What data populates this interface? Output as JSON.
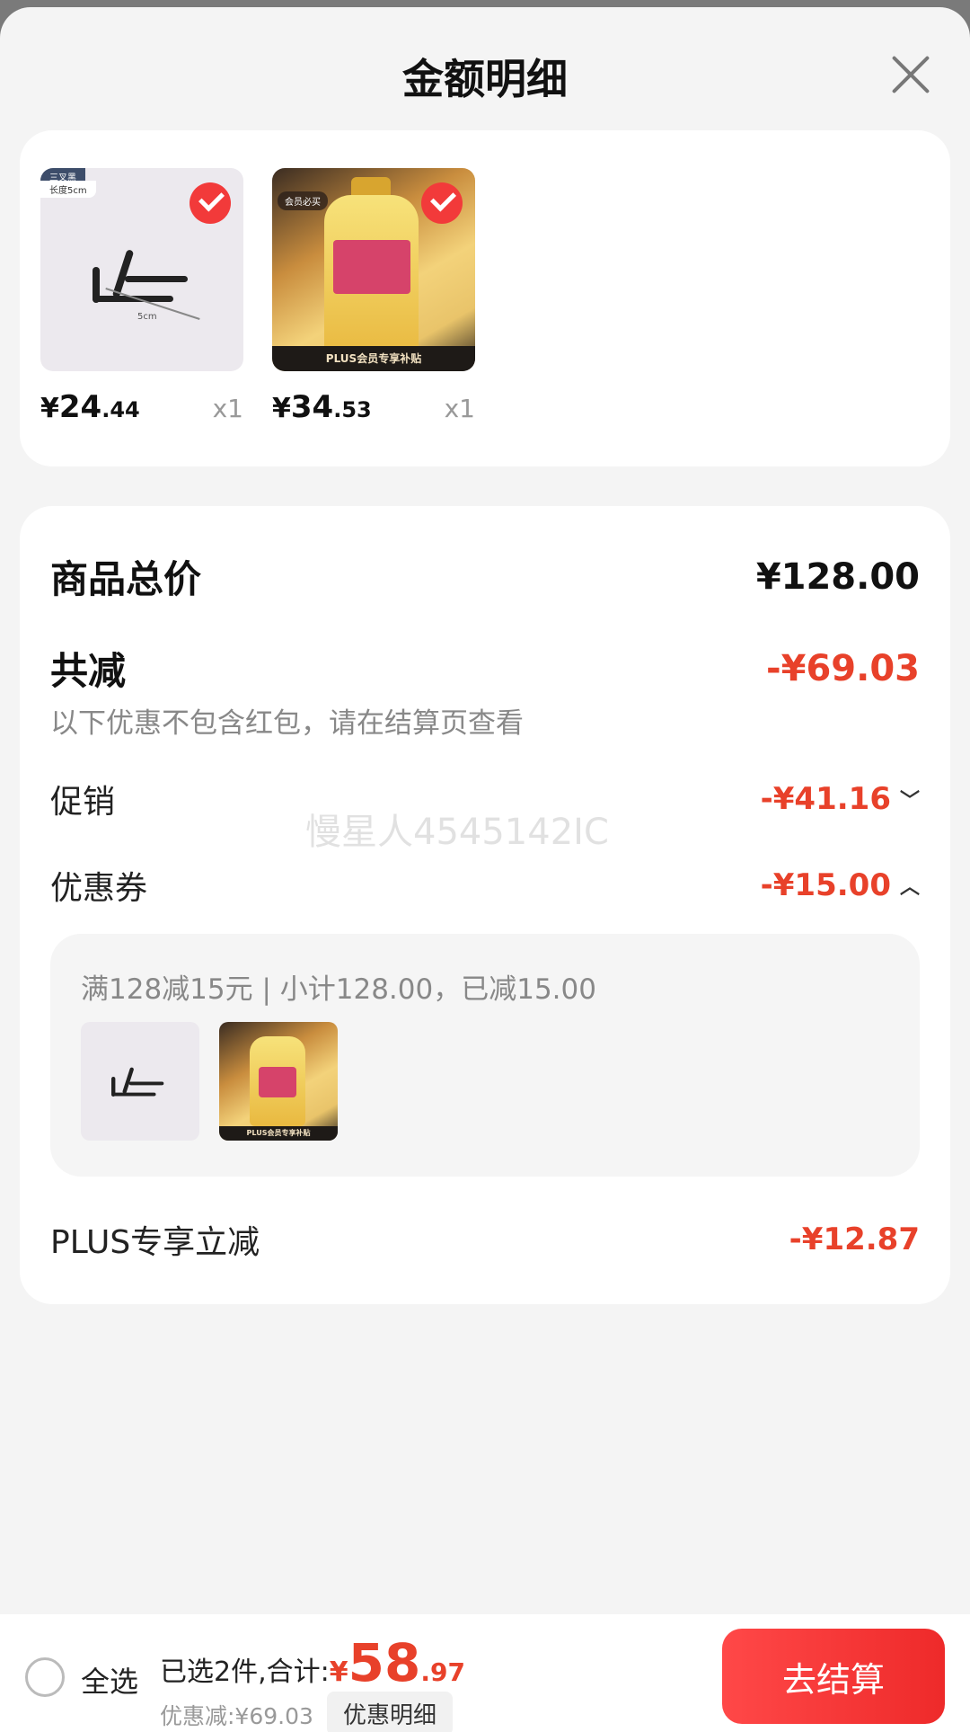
{
  "header": {
    "title": "金额明细"
  },
  "products": [
    {
      "tag_top": "三叉黑",
      "tag_bottom": "长度5cm",
      "dimension": "5cm",
      "price_int": "24",
      "price_dec": ".44",
      "qty": "x1"
    },
    {
      "member_tag": "会员必买",
      "band": "PLUS会员专享补贴",
      "price_int": "34",
      "price_dec": ".53",
      "qty": "x1"
    }
  ],
  "currency": "¥",
  "details": {
    "total_label": "商品总价",
    "total_value": "¥128.00",
    "reduce_label": "共减",
    "reduce_value": "-¥69.03",
    "note": "以下优惠不包含红包，请在结算页查看",
    "promo_label": "促销",
    "promo_value": "-¥41.16",
    "coupon_label": "优惠券",
    "coupon_value": "-¥15.00",
    "coupon_rule": "满128减15元 | 小计128.00，已减15.00",
    "plus_label": "PLUS专享立减",
    "plus_value": "-¥12.87",
    "watermark": "慢星人4545142IC"
  },
  "bottom_bar": {
    "select_all": "全选",
    "selected_summary": "已选2件,合计:",
    "total_yen": "¥",
    "total_int": "58",
    "total_dec": ".97",
    "discount": "优惠减:¥69.03",
    "detail_button": "优惠明细",
    "checkout": "去结算"
  },
  "colors": {
    "accent": "#e8412a",
    "checkout": "#ff3b3b"
  }
}
